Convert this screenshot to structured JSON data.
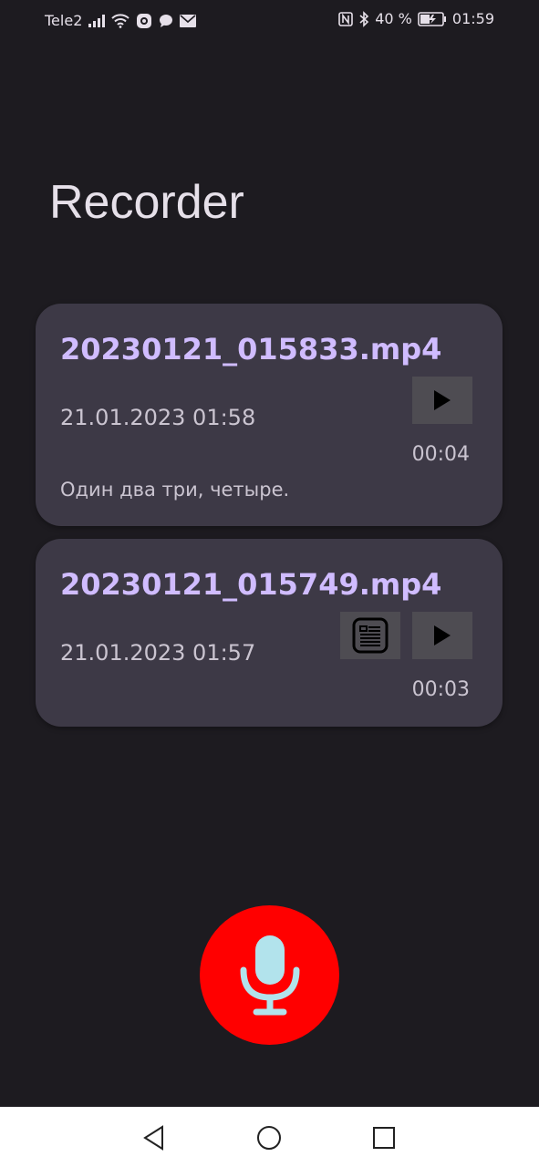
{
  "status_bar": {
    "carrier": "Tele2",
    "battery_percent": "40 %",
    "time": "01:59",
    "icons": [
      "signal-icon",
      "wifi-icon",
      "app-notification-icon",
      "message-icon",
      "mail-icon",
      "nfc-icon",
      "bluetooth-icon",
      "battery-charging-icon"
    ]
  },
  "app": {
    "title": "Recorder"
  },
  "recordings": [
    {
      "filename": "20230121_015833.mp4",
      "date": "21.01.2023 01:58",
      "duration": "00:04",
      "transcript": "Один два три, четыре."
    },
    {
      "filename": "20230121_015749.mp4",
      "date": "21.01.2023 01:57",
      "duration": "00:03"
    }
  ],
  "colors": {
    "background": "#1d1b20",
    "card": "#3d3946",
    "filename": "#d0bcff",
    "record_button": "#ff0000",
    "mic_icon": "#b2e3ec"
  },
  "nav_bar": {
    "icons": [
      "back-icon",
      "home-icon",
      "recents-icon"
    ]
  }
}
